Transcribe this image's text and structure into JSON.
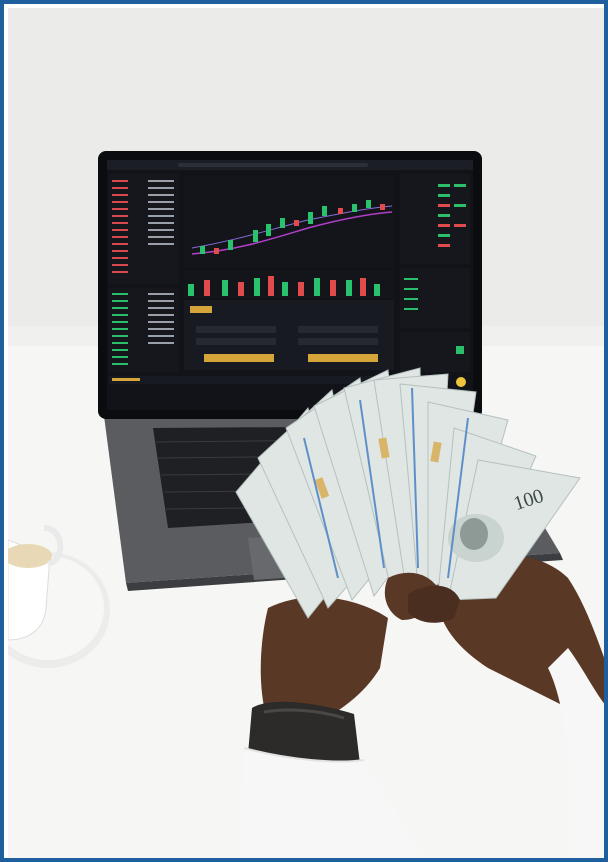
{
  "image": {
    "subject": "hands-holding-dollar-bills-in-front-of-trading-laptop",
    "colors": {
      "frame_border": "#1f5f9e",
      "wall": "#ebebea",
      "table": "#f6f6f4",
      "laptop_body": "#55575b",
      "screen_bg": "#111319",
      "candle_green": "#29c26d",
      "candle_red": "#e24b4b",
      "bill_tint": "#dfe6e4",
      "skin": "#5a3826",
      "sleeve": "#f7f7f7"
    },
    "screen_labels": {
      "bill_denomination": "100"
    }
  }
}
